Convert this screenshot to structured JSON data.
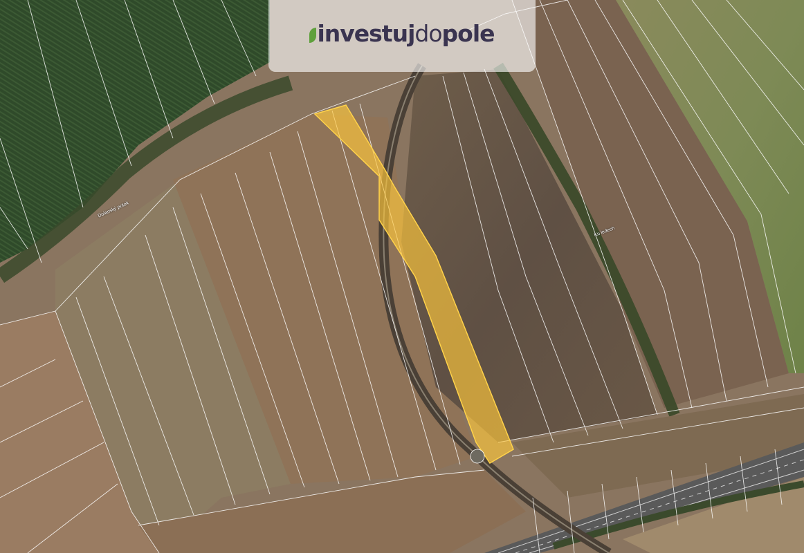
{
  "logo": {
    "brand_part1": "investuj",
    "brand_part2": "do",
    "brand_part3": "pole",
    "leaf_icon": "leaf-icon",
    "text_color": "#3a3450",
    "leaf_color": "#5fa03c"
  },
  "map": {
    "street_labels": [
      "Dolanský potok",
      "Ku ledech"
    ],
    "highlight_color": "#ffc83c",
    "parcel_line_color": "#ffffff"
  }
}
